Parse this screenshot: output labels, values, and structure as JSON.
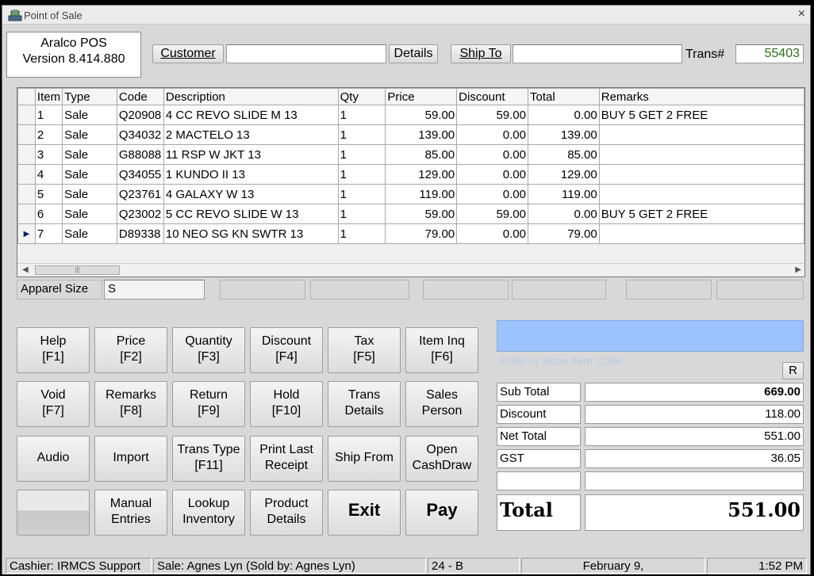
{
  "window": {
    "title": "Point of Sale",
    "close_glyph": "×"
  },
  "version": {
    "line1": "Aralco POS",
    "line2": "Version 8.414.880"
  },
  "header": {
    "customer_label": "Customer",
    "customer_value": "",
    "details_label": "Details",
    "shipto_label": "Ship To",
    "shipto_value": "",
    "trans_label": "Trans#",
    "trans_value": "55403",
    "trans_color": "#2e6e1e"
  },
  "grid": {
    "columns": [
      "Item",
      "Type",
      "Code",
      "Description",
      "Qty",
      "Price",
      "Discount",
      "Total",
      "Remarks"
    ],
    "rows": [
      {
        "item": "1",
        "type": "Sale",
        "code": "Q20908",
        "description": "4 CC REVO SLIDE M 13",
        "qty": "1",
        "price": "59.00",
        "discount": "59.00",
        "total": "0.00",
        "remarks": "BUY 5 GET 2 FREE"
      },
      {
        "item": "2",
        "type": "Sale",
        "code": "Q34032",
        "description": "2 MACTELO 13",
        "qty": "1",
        "price": "139.00",
        "discount": "0.00",
        "total": "139.00",
        "remarks": ""
      },
      {
        "item": "3",
        "type": "Sale",
        "code": "G88088",
        "description": "11 RSP W JKT 13",
        "qty": "1",
        "price": "85.00",
        "discount": "0.00",
        "total": "85.00",
        "remarks": ""
      },
      {
        "item": "4",
        "type": "Sale",
        "code": "Q34055",
        "description": "1 KUNDO II 13",
        "qty": "1",
        "price": "129.00",
        "discount": "0.00",
        "total": "129.00",
        "remarks": ""
      },
      {
        "item": "5",
        "type": "Sale",
        "code": "Q23761",
        "description": "4 GALAXY W 13",
        "qty": "1",
        "price": "119.00",
        "discount": "0.00",
        "total": "119.00",
        "remarks": ""
      },
      {
        "item": "6",
        "type": "Sale",
        "code": "Q23002",
        "description": "5 CC REVO SLIDE W 13",
        "qty": "1",
        "price": "59.00",
        "discount": "59.00",
        "total": "0.00",
        "remarks": "BUY 5 GET 2 FREE"
      },
      {
        "item": "7",
        "type": "Sale",
        "code": "D89338",
        "description": "10 NEO SG KN SWTR 13",
        "qty": "1",
        "price": "79.00",
        "discount": "0.00",
        "total": "79.00",
        "remarks": ""
      }
    ],
    "current_row_indicator": "▶"
  },
  "attributes": {
    "label": "Apparel Size",
    "value": "S"
  },
  "buttons": {
    "help": {
      "name": "Help",
      "key": "[F1]"
    },
    "price": {
      "name": "Price",
      "key": "[F2]"
    },
    "quantity": {
      "name": "Quantity",
      "key": "[F3]"
    },
    "discount": {
      "name": "Discount",
      "key": "[F4]"
    },
    "tax": {
      "name": "Tax",
      "key": "[F5]"
    },
    "item_inq": {
      "name": "Item Inq",
      "key": "[F6]"
    },
    "void": {
      "name": "Void",
      "key": "[F7]"
    },
    "remarks": {
      "name": "Remarks",
      "key": "[F8]"
    },
    "return": {
      "name": "Return",
      "key": "[F9]"
    },
    "hold": {
      "name": "Hold",
      "key": "[F10]"
    },
    "trans_details": {
      "line1": "Trans",
      "line2": "Details"
    },
    "sales_person": {
      "line1": "Sales",
      "line2": "Person"
    },
    "audio": "Audio",
    "import": "Import",
    "trans_type": {
      "name": "Trans Type",
      "key": "[F11]"
    },
    "print_last": {
      "line1": "Print Last",
      "line2": "Receipt"
    },
    "ship_from": "Ship From",
    "open_cashdraw": {
      "line1": "Open",
      "line2": "CashDraw"
    },
    "manual_entries": {
      "line1": "Manual",
      "line2": "Entries"
    },
    "lookup_inventory": {
      "line1": "Lookup",
      "line2": "Inventory"
    },
    "product_details": {
      "line1": "Product",
      "line2": "Details"
    },
    "exit": "Exit",
    "pay": "Pay"
  },
  "scan": {
    "placeholder": "Enter or Scan Item Code",
    "r_label": "R",
    "bg_color": "#9ac3ff"
  },
  "totals": {
    "subtotal_label": "Sub Total",
    "subtotal_value": "669.00",
    "discount_label": "Discount",
    "discount_value": "118.00",
    "net_label": "Net Total",
    "net_value": "551.00",
    "gst_label": "GST",
    "gst_value": "36.05",
    "total_label": "Total",
    "total_value": "551.00"
  },
  "status": {
    "cashier": "Cashier: IRMCS Support",
    "sale": "Sale: Agnes Lyn   (Sold by: Agnes Lyn)",
    "station": "24 - B",
    "date": "February 9,",
    "time": "1:52 PM"
  }
}
